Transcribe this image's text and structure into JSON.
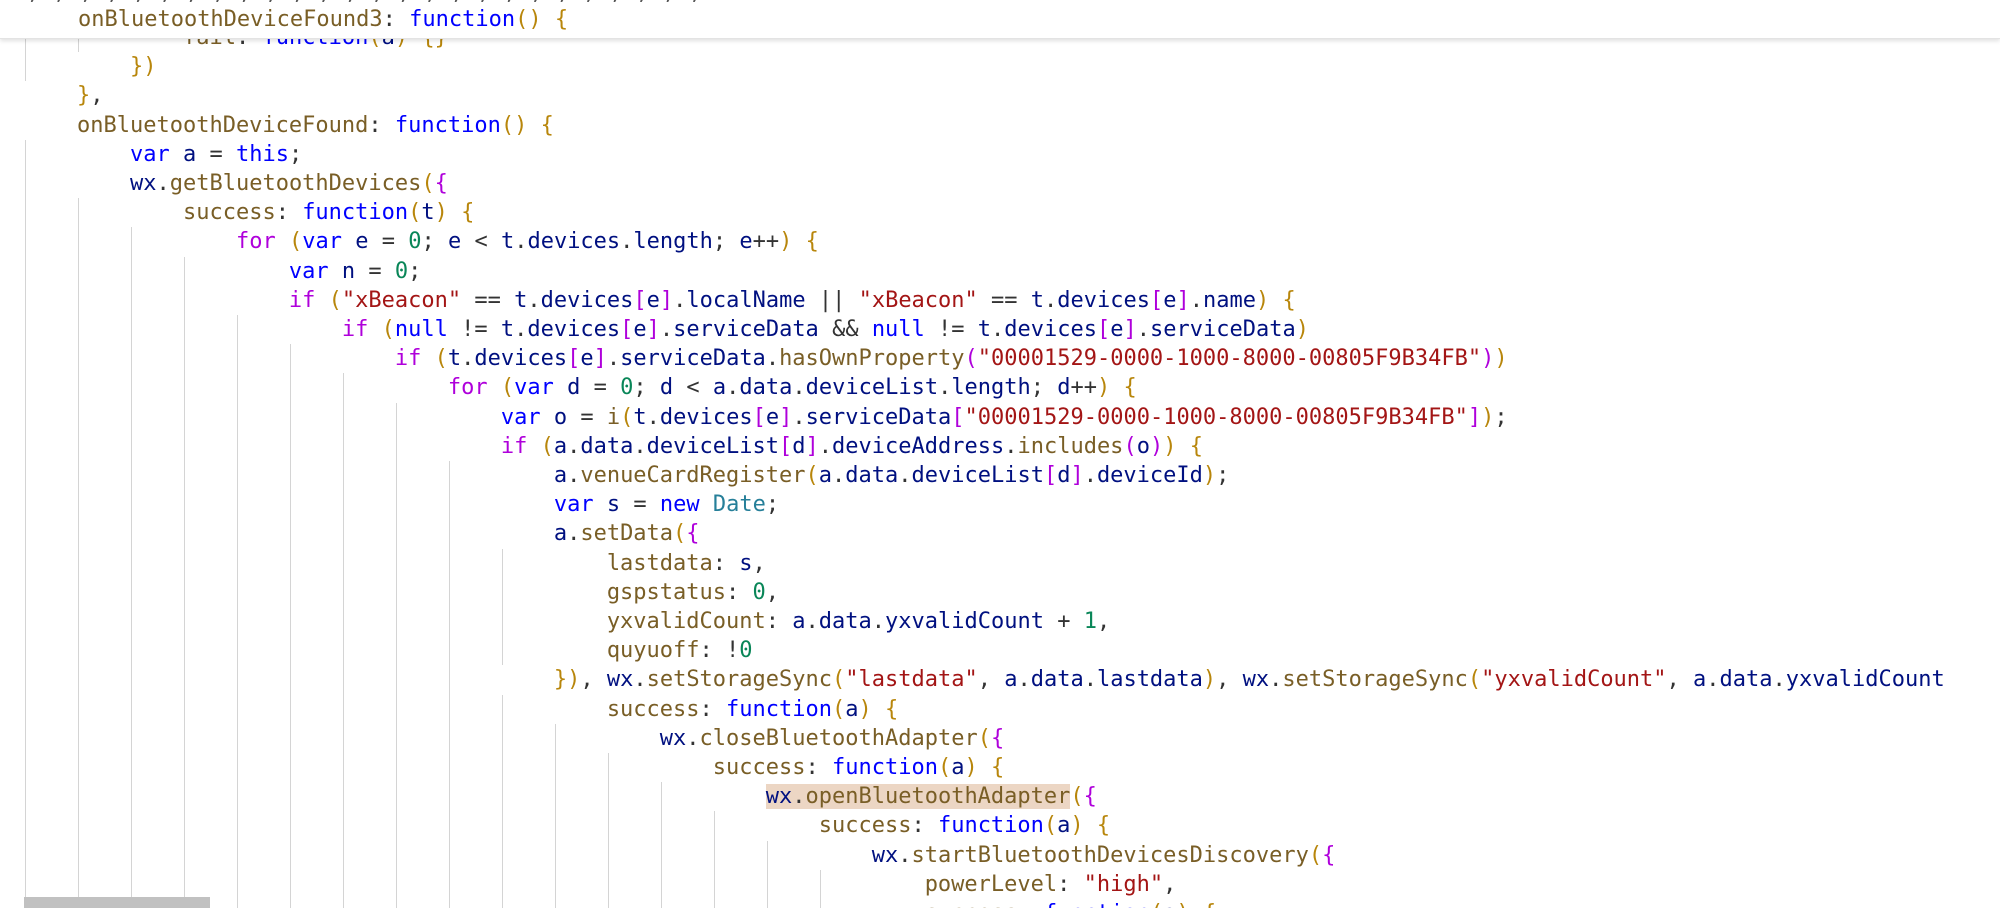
{
  "colors": {
    "default": "#333333",
    "keyword": "#0000ff",
    "control": "#af00db",
    "string": "#a31515",
    "number": "#098658",
    "method": "#795e26",
    "class": "#267f99",
    "property": "#001080",
    "bracket_gold": "#b8860b",
    "bracket_purple": "#af00db",
    "bracket_blue": "#0451a5",
    "match_highlight": "#ecd6c4"
  },
  "sticky": {
    "topline": "  , ; , ; , ; , ; , ; , ; , ; , ; , ; , ; , ; , ; , ;",
    "header": "onBluetoothDeviceFound3: function() {"
  },
  "code": {
    "lines": [
      "        fail: function(a) {}",
      "    })",
      "},",
      "onBluetoothDeviceFound: function() {",
      "    var a = this;",
      "    wx.getBluetoothDevices({",
      "        success: function(t) {",
      "            for (var e = 0; e < t.devices.length; e++) {",
      "                var n = 0;",
      "                if (\"xBeacon\" == t.devices[e].localName || \"xBeacon\" == t.devices[e].name) {",
      "                    if (null != t.devices[e].serviceData && null != t.devices[e].serviceData)",
      "                        if (t.devices[e].serviceData.hasOwnProperty(\"00001529-0000-1000-8000-00805F9B34FB\"))",
      "                            for (var d = 0; d < a.data.deviceList.length; d++) {",
      "                                var o = i(t.devices[e].serviceData[\"00001529-0000-1000-8000-00805F9B34FB\"]);",
      "                                if (a.data.deviceList[d].deviceAddress.includes(o)) {",
      "                                    a.venueCardRegister(a.data.deviceList[d].deviceId);",
      "                                    var s = new Date;",
      "                                    a.setData({",
      "                                        lastdata: s,",
      "                                        gspstatus: 0,",
      "                                        yxvalidCount: a.data.yxvalidCount + 1,",
      "                                        quyuoff: !0",
      "                                    }), wx.setStorageSync(\"lastdata\", a.data.lastdata), wx.setStorageSync(\"yxvalidCount\", a.data.yxvalidCount",
      "                                        success: function(a) {",
      "                                            wx.closeBluetoothAdapter({",
      "                                                success: function(a) {",
      "                                                    wx.openBluetoothAdapter({",
      "                                                        success: function(a) {",
      "                                                            wx.startBluetoothDevicesDiscovery({",
      "                                                                powerLevel: \"high\",",
      "                                                                success: function(a) {"
    ]
  }
}
